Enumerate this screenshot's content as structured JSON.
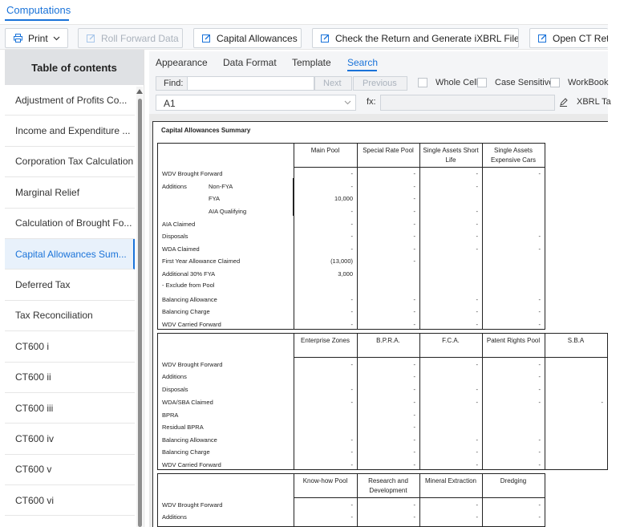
{
  "app": {
    "title": "Computations"
  },
  "toolbar": {
    "print": "Print",
    "roll_forward": "Roll Forward Data",
    "capital_allowances": "Capital Allowances",
    "check_return": "Check the Return and Generate iXBRL Files",
    "open_ct": "Open CT Retu"
  },
  "toc": {
    "heading": "Table of contents",
    "items": [
      "Adjustment of Profits Co...",
      "Income and Expenditure ...",
      "Corporation Tax Calculation",
      "Marginal Relief",
      "Calculation of Brought Fo...",
      "Capital Allowances Sum...",
      "Deferred Tax",
      "Tax Reconciliation",
      "CT600 i",
      "CT600 ii",
      "CT600 iii",
      "CT600 iv",
      "CT600 v",
      "CT600 vi"
    ],
    "selected_index": 5
  },
  "tabs": [
    "Appearance",
    "Data Format",
    "Template",
    "Search"
  ],
  "active_tab": "Search",
  "find": {
    "label": "Find:",
    "value": "",
    "next": "Next",
    "previous": "Previous",
    "whole_cell": "Whole Cell",
    "case_sensitive": "Case Sensitive",
    "workbook": "WorkBook"
  },
  "cell": {
    "ref": "A1",
    "fx": "fx:",
    "formula": "",
    "xbrl": "XBRL Ta"
  },
  "sheet": {
    "title": "Capital Allowances Summary",
    "t1": {
      "headers": [
        "Main Pool",
        "Special Rate Pool",
        "Single Assets Short Life",
        "Single Assets Expensive Cars"
      ],
      "rows": [
        {
          "label": "WDV Brought Forward",
          "vals": [
            "-",
            "-",
            "-",
            "-"
          ]
        },
        {
          "label": "Additions",
          "sub": "Non-FYA",
          "vals": [
            "-",
            "-",
            "-",
            ""
          ]
        },
        {
          "label": "",
          "sub": "FYA",
          "vals": [
            "10,000",
            "-",
            "",
            ""
          ]
        },
        {
          "label": "",
          "sub": "AIA Qualifying",
          "vals": [
            "-",
            "-",
            "-",
            ""
          ]
        },
        {
          "label": "AIA Claimed",
          "vals": [
            "-",
            "-",
            "-",
            ""
          ]
        },
        {
          "label": "Disposals",
          "vals": [
            "-",
            "-",
            "-",
            "-"
          ]
        },
        {
          "label": "WDA Claimed",
          "vals": [
            "-",
            "-",
            "-",
            "-"
          ]
        },
        {
          "label": "First Year Allowance Claimed",
          "vals": [
            "(13,000)",
            "-",
            "",
            ""
          ]
        },
        {
          "label": "Additional 30% FYA",
          "vals": [
            "3,000",
            "",
            "",
            ""
          ]
        },
        {
          "label": "- Exclude from Pool",
          "vals": [
            "",
            "",
            "",
            ""
          ]
        },
        {
          "label": "Balancing Allowance",
          "vals": [
            "-",
            "-",
            "-",
            "-"
          ]
        },
        {
          "label": "Balancing Charge",
          "vals": [
            "-",
            "-",
            "-",
            "-"
          ]
        },
        {
          "label": "WDV Carried Forward",
          "vals": [
            "-",
            "-",
            "-",
            "-"
          ]
        }
      ]
    },
    "t2": {
      "headers": [
        "Enterprise Zones",
        "B.P.R.A.",
        "F.C.A.",
        "Patent Rights Pool",
        "S.B.A"
      ],
      "rows": [
        {
          "label": "WDV Brought Forward",
          "vals": [
            "-",
            "-",
            "-",
            "-",
            ""
          ]
        },
        {
          "label": "Additions",
          "vals": [
            "",
            "-",
            "",
            "-",
            ""
          ]
        },
        {
          "label": "Disposals",
          "vals": [
            "-",
            "-",
            "-",
            "-",
            ""
          ]
        },
        {
          "label": "WDA/SBA Claimed",
          "vals": [
            "-",
            "-",
            "-",
            "-",
            "-"
          ]
        },
        {
          "label": "BPRA",
          "vals": [
            "",
            "-",
            "",
            "",
            ""
          ]
        },
        {
          "label": "Residual BPRA",
          "vals": [
            "",
            "-",
            "",
            "",
            ""
          ]
        },
        {
          "label": "Balancing Allowance",
          "vals": [
            "-",
            "-",
            "-",
            "-",
            ""
          ]
        },
        {
          "label": "Balancing Charge",
          "vals": [
            "-",
            "-",
            "-",
            "-",
            ""
          ]
        },
        {
          "label": "WDV Carried Forward",
          "vals": [
            "-",
            "-",
            "-",
            "-",
            ""
          ]
        }
      ]
    },
    "t3": {
      "headers": [
        "Know-how Pool",
        "Research and Development",
        "Mineral Extraction",
        "Dredging"
      ],
      "rows": [
        {
          "label": "WDV Brought Forward",
          "vals": [
            "-",
            "-",
            "-",
            "-"
          ]
        },
        {
          "label": "Additions",
          "vals": [
            "-",
            "-",
            "-",
            "-"
          ]
        }
      ]
    }
  }
}
